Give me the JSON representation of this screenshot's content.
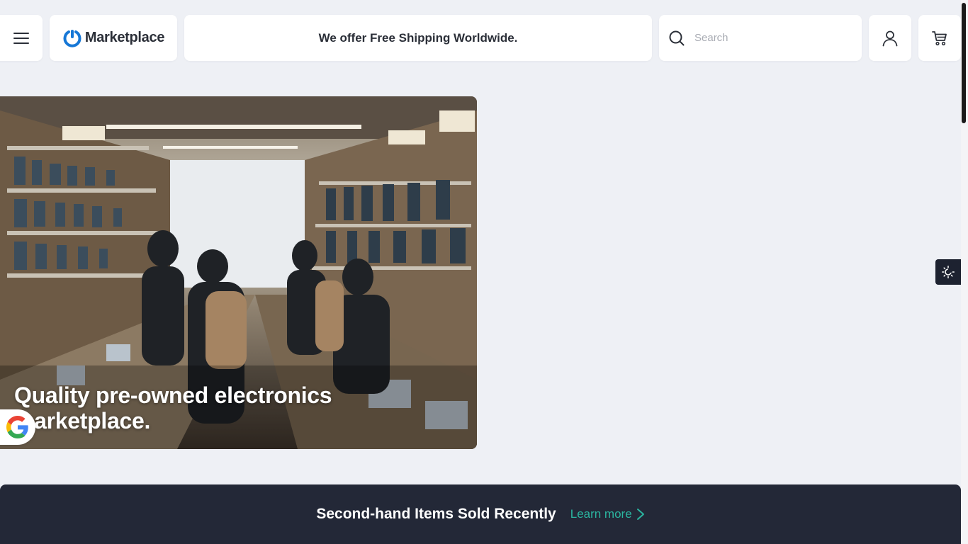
{
  "header": {
    "menu_icon": "hamburger-menu-icon",
    "logo_text": "Marketplace",
    "promo_text": "We offer Free Shipping Worldwide.",
    "search_placeholder": "Search",
    "search_value": "",
    "account_icon": "user-icon",
    "cart_icon": "cart-icon"
  },
  "hero": {
    "title": "Quality pre-owned electronics marketplace.",
    "image_description_icon": "electronics-store-photo"
  },
  "google_badge_icon": "google-icon",
  "theme_toggle_icon": "sun-moon-icon",
  "sold_section": {
    "title": "Second-hand Items Sold Recently",
    "link_label": "Learn more"
  },
  "colors": {
    "page_bg": "#eef0f5",
    "banner_bg": "#232837",
    "accent": "#2bb5a0",
    "logo_blue": "#1677d6"
  }
}
